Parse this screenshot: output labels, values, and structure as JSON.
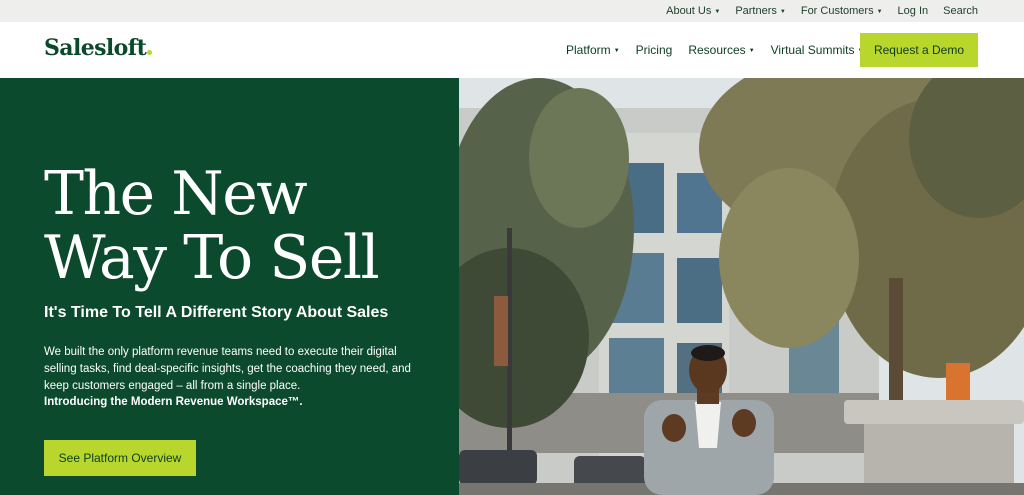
{
  "utility_nav": {
    "items": [
      {
        "label": "About Us",
        "has_caret": true
      },
      {
        "label": "Partners",
        "has_caret": true
      },
      {
        "label": "For Customers",
        "has_caret": true
      },
      {
        "label": "Log In",
        "has_caret": false
      },
      {
        "label": "Search",
        "has_caret": false
      }
    ]
  },
  "header": {
    "logo_text": "Salesloft",
    "nav": [
      {
        "label": "Platform",
        "has_caret": true
      },
      {
        "label": "Pricing",
        "has_caret": false
      },
      {
        "label": "Resources",
        "has_caret": true
      },
      {
        "label": "Virtual Summits",
        "has_caret": true
      }
    ],
    "cta_label": "Request a Demo"
  },
  "hero": {
    "title_line1": "The New",
    "title_line2": "Way To Sell",
    "subtitle": "It's Time To Tell A Different Story About Sales",
    "body": "We built the only platform revenue teams need to execute their digital selling tasks, find deal-specific insights, get the coaching they need, and keep customers engaged – all from a single place.",
    "body_strong": "Introducing the Modern Revenue Workspace™.",
    "cta_label": "See Platform Overview"
  },
  "colors": {
    "brand_green": "#0b4a2c",
    "accent_lime": "#b8d62b",
    "utility_bg": "#eeeeed"
  },
  "icons": {
    "caret": "caret-down-icon",
    "logo_dot": "logo-dot-icon"
  }
}
